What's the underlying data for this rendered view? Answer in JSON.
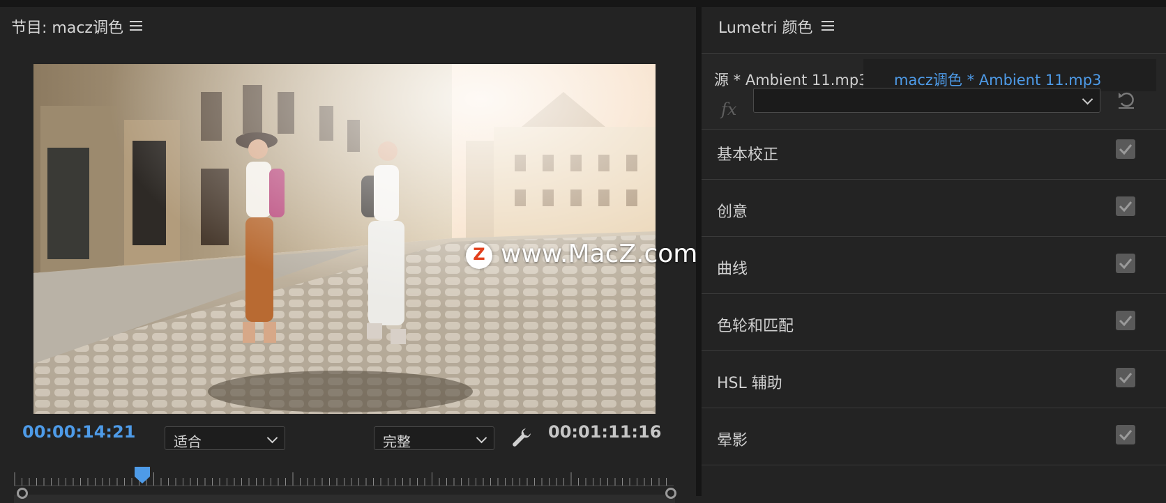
{
  "program": {
    "title": "节目: macz调色",
    "current_timecode": "00:00:14:21",
    "duration_timecode": "00:01:11:16",
    "fit_dropdown": "适合",
    "quality_dropdown": "完整",
    "playhead_fraction": 0.195
  },
  "lumetri": {
    "title": "Lumetri 颜色",
    "source_label": "源 * Ambient 11.mp3",
    "target_label": "macz调色 * Ambient 11.mp3",
    "fx_label": "fx",
    "effect_selection": "",
    "sections": [
      {
        "label": "基本校正",
        "checked": true
      },
      {
        "label": "创意",
        "checked": true
      },
      {
        "label": "曲线",
        "checked": true
      },
      {
        "label": "色轮和匹配",
        "checked": true
      },
      {
        "label": "HSL 辅助",
        "checked": true
      },
      {
        "label": "晕影",
        "checked": true
      }
    ]
  },
  "watermark": {
    "logo_letter": "Z",
    "text": "www.MacZ.com"
  },
  "colors": {
    "accent_blue": "#4e9be8",
    "panel_bg": "#232323",
    "brand_red": "#e2401c"
  },
  "icons": [
    "panel-menu-icon",
    "chevron-down-icon",
    "wrench-icon",
    "reset-icon",
    "checkbox-check-icon",
    "playhead-icon"
  ]
}
